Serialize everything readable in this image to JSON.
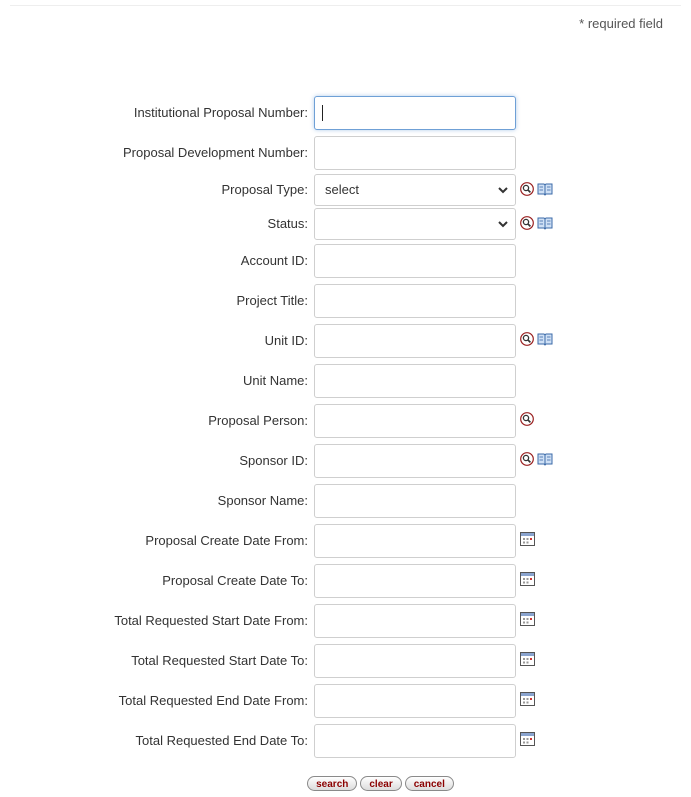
{
  "header": {
    "required_note": "* required field"
  },
  "fields": [
    {
      "label": "Institutional Proposal Number:",
      "value": ""
    },
    {
      "label": "Proposal Development Number:",
      "value": ""
    },
    {
      "label": "Proposal Type:",
      "value": "select"
    },
    {
      "label": "Status:",
      "value": ""
    },
    {
      "label": "Account ID:",
      "value": ""
    },
    {
      "label": "Project Title:",
      "value": ""
    },
    {
      "label": "Unit ID:",
      "value": ""
    },
    {
      "label": "Unit Name:",
      "value": ""
    },
    {
      "label": "Proposal Person:",
      "value": ""
    },
    {
      "label": "Sponsor ID:",
      "value": ""
    },
    {
      "label": "Sponsor Name:",
      "value": ""
    },
    {
      "label": "Proposal Create Date From:",
      "value": ""
    },
    {
      "label": "Proposal Create Date To:",
      "value": ""
    },
    {
      "label": "Total Requested Start Date From:",
      "value": ""
    },
    {
      "label": "Total Requested Start Date To:",
      "value": ""
    },
    {
      "label": "Total Requested End Date From:",
      "value": ""
    },
    {
      "label": "Total Requested End Date To:",
      "value": ""
    }
  ],
  "buttons": {
    "search": "search",
    "clear": "clear",
    "cancel": "cancel"
  },
  "colors": {
    "button_text": "#8b0000",
    "focus_border": "#6fa0d6"
  }
}
